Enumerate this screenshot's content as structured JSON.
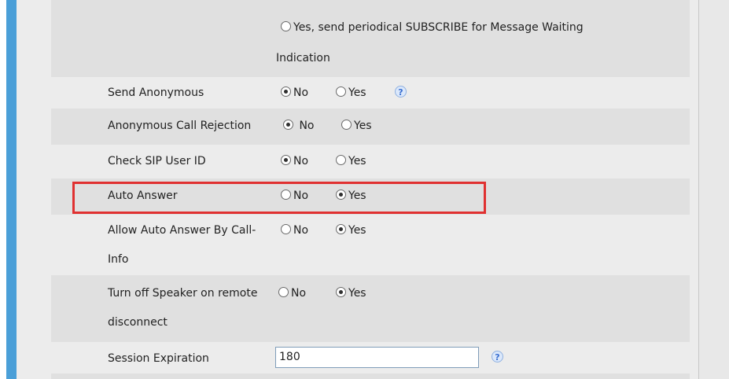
{
  "mwi": {
    "option_label_line1": "Yes, send periodical SUBSCRIBE for Message Waiting",
    "option_label_line2": "Indication"
  },
  "settings": [
    {
      "label": "Send Anonymous",
      "no": "No",
      "yes": "Yes",
      "selected": "No"
    },
    {
      "label": "Anonymous Call Rejection",
      "no": "No",
      "yes": "Yes",
      "selected": "No"
    },
    {
      "label": "Check SIP User ID",
      "no": "No",
      "yes": "Yes",
      "selected": "No"
    },
    {
      "label": "Auto Answer",
      "no": "No",
      "yes": "Yes",
      "selected": "Yes"
    },
    {
      "label_line1": "Allow Auto Answer By Call-",
      "label_line2": "Info",
      "no": "No",
      "yes": "Yes",
      "selected": "Yes"
    },
    {
      "label_line1": "Turn off Speaker on remote",
      "label_line2": "disconnect",
      "no": "No",
      "yes": "Yes",
      "selected": "Yes"
    }
  ],
  "session_expiration": {
    "label": "Session Expiration",
    "value": "180"
  },
  "icons": {
    "help": "help-icon"
  },
  "colors": {
    "accent": "#4a9fd8",
    "highlight": "#e03131"
  }
}
